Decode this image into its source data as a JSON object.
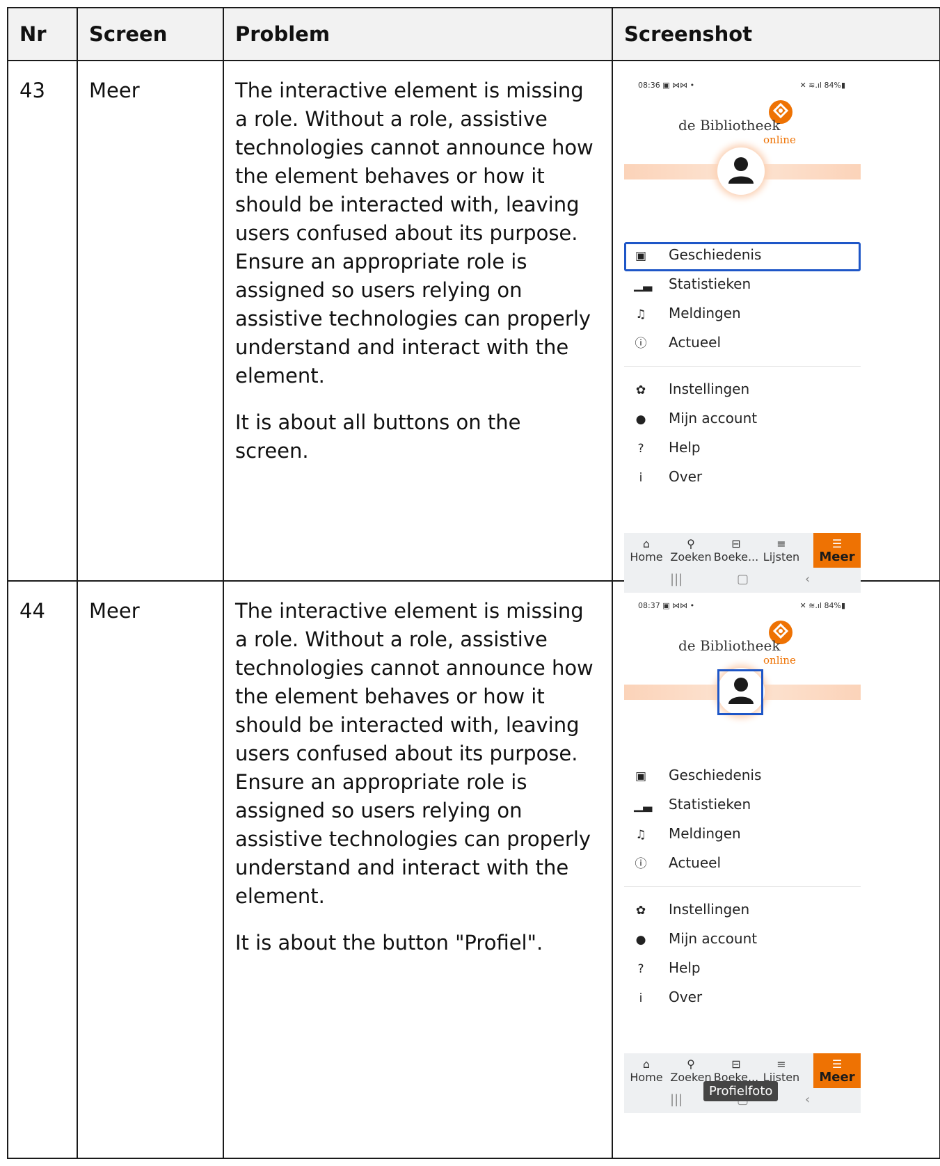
{
  "table": {
    "headers": [
      "Nr",
      "Screen",
      "Problem",
      "Screenshot"
    ],
    "rows": [
      {
        "nr": "43",
        "screen": "Meer",
        "problem": "The interactive element is missing a role. Without a role, assistive technologies cannot announce how the element behaves or how it should be interacted with, leaving users confused about its purpose. Ensure an appropriate role is assigned so users relying on assistive technologies can properly understand and interact with the element.",
        "note": "It is about all buttons on the screen.",
        "screenshot": {
          "status_time": "08:36 ▣ ⋈⋈ •",
          "status_right": "✕ ≋.ıl 84%▮"
        }
      },
      {
        "nr": "44",
        "screen": "Meer",
        "problem": "The interactive element is missing a role. Without a role, assistive technologies cannot announce how the element behaves or how it should be interacted with, leaving users confused about its purpose. Ensure an appropriate role is assigned so users relying on assistive technologies can properly understand and interact with the element.",
        "note": "It is about the button \"Profiel\".",
        "screenshot": {
          "status_time": "08:37 ▣ ⋈⋈ •",
          "status_right": "✕ ≋.ıl 84%▮",
          "tooltip": "Profielfoto"
        }
      }
    ]
  },
  "app": {
    "logo_text": "de Bibliotheek",
    "logo_sub": "online",
    "brand_color": "#ee7203",
    "focus_color": "#1e56c7",
    "menu_group1": [
      {
        "label": "Geschiedenis",
        "icon": "history-icon"
      },
      {
        "label": "Statistieken",
        "icon": "bar-chart-icon"
      },
      {
        "label": "Meldingen",
        "icon": "bell-icon"
      },
      {
        "label": "Actueel",
        "icon": "alert-circle-icon"
      }
    ],
    "menu_group2": [
      {
        "label": "Instellingen",
        "icon": "gear-icon"
      },
      {
        "label": "Mijn account",
        "icon": "user-icon"
      },
      {
        "label": "Help",
        "icon": "help-icon"
      },
      {
        "label": "Over",
        "icon": "info-icon"
      }
    ],
    "tabs": [
      {
        "label": "Home",
        "icon": "home-icon"
      },
      {
        "label": "Zoeken",
        "icon": "search-icon"
      },
      {
        "label": "Boeke...",
        "icon": "book-icon"
      },
      {
        "label": "Lijsten",
        "icon": "list-icon"
      },
      {
        "label": "Meer",
        "icon": "menu-icon"
      }
    ]
  }
}
